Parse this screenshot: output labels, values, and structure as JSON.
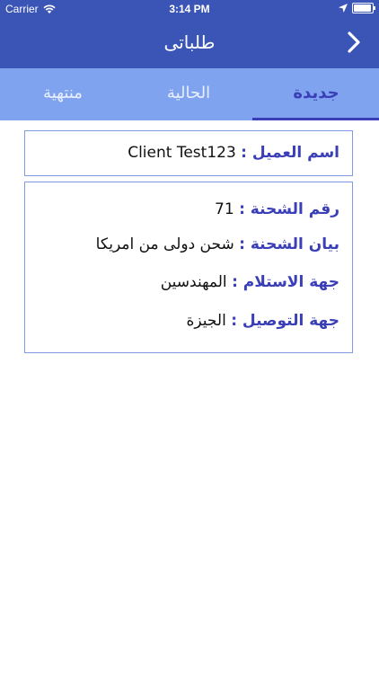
{
  "status_bar": {
    "carrier": "Carrier",
    "time": "3:14 PM"
  },
  "header": {
    "title": "طلباتى"
  },
  "tabs": [
    {
      "label": "جديدة",
      "active": true
    },
    {
      "label": "الحالية",
      "active": false
    },
    {
      "label": "منتهية",
      "active": false
    }
  ],
  "client": {
    "label": "اسم العميل :",
    "value": "Client Test123"
  },
  "shipment": {
    "number_label": "رقم الشحنة :",
    "number_value": "71",
    "desc_label": "بيان الشحنة :",
    "desc_value": "شحن دولى من امريكا",
    "pickup_label": "جهة الاستلام :",
    "pickup_value": "المهندسين",
    "delivery_label": "جهة التوصيل :",
    "delivery_value": "الجيزة"
  },
  "colors": {
    "primary": "#3b55b6",
    "tab_bar": "#7fa3ee",
    "accent": "#3a3fb8",
    "border": "#7f9be6"
  }
}
